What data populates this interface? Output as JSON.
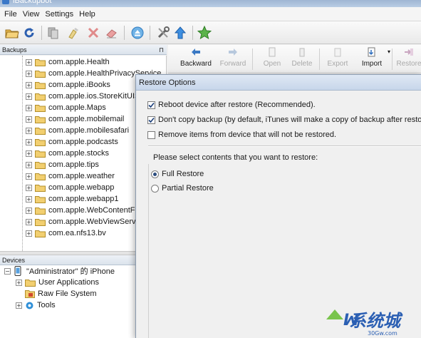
{
  "window": {
    "title": "iBackupbot"
  },
  "menu": [
    "File",
    "View",
    "Settings",
    "Help"
  ],
  "backups": {
    "header": "Backups",
    "items": [
      "com.apple.Health",
      "com.apple.HealthPrivacyService",
      "com.apple.iBooks",
      "com.apple.ios.StoreKitUISe",
      "com.apple.Maps",
      "com.apple.mobilemail",
      "com.apple.mobilesafari",
      "com.apple.podcasts",
      "com.apple.stocks",
      "com.apple.tips",
      "com.apple.weather",
      "com.apple.webapp",
      "com.apple.webapp1",
      "com.apple.WebContentFilter",
      "com.apple.WebViewService",
      "com.ea.nfs13.bv"
    ]
  },
  "devices": {
    "header": "Devices",
    "device_name": "\"Administrator\" 的 iPhone",
    "children": [
      "User Applications",
      "Raw File System",
      "Tools"
    ]
  },
  "right_toolbar": {
    "backward": "Backward",
    "forward": "Forward",
    "open": "Open",
    "delete": "Delete",
    "export": "Export",
    "import": "Import",
    "restore": "Restore"
  },
  "dialog": {
    "title": "Restore Options",
    "options": [
      {
        "label": "Reboot device after restore (Recommended).",
        "checked": true
      },
      {
        "label": "Don't copy backup (by default, iTunes will make a copy of backup after restore).",
        "checked": true
      },
      {
        "label": "Remove items from device that will not be restored.",
        "checked": false
      }
    ],
    "contents_label": "Please select contents that you want to restore:",
    "restore_modes": [
      {
        "label": "Full Restore",
        "selected": true
      },
      {
        "label": "Partial Restore",
        "selected": false
      }
    ]
  },
  "watermark": {
    "text": "系统城",
    "domain": "30Gw.com"
  }
}
